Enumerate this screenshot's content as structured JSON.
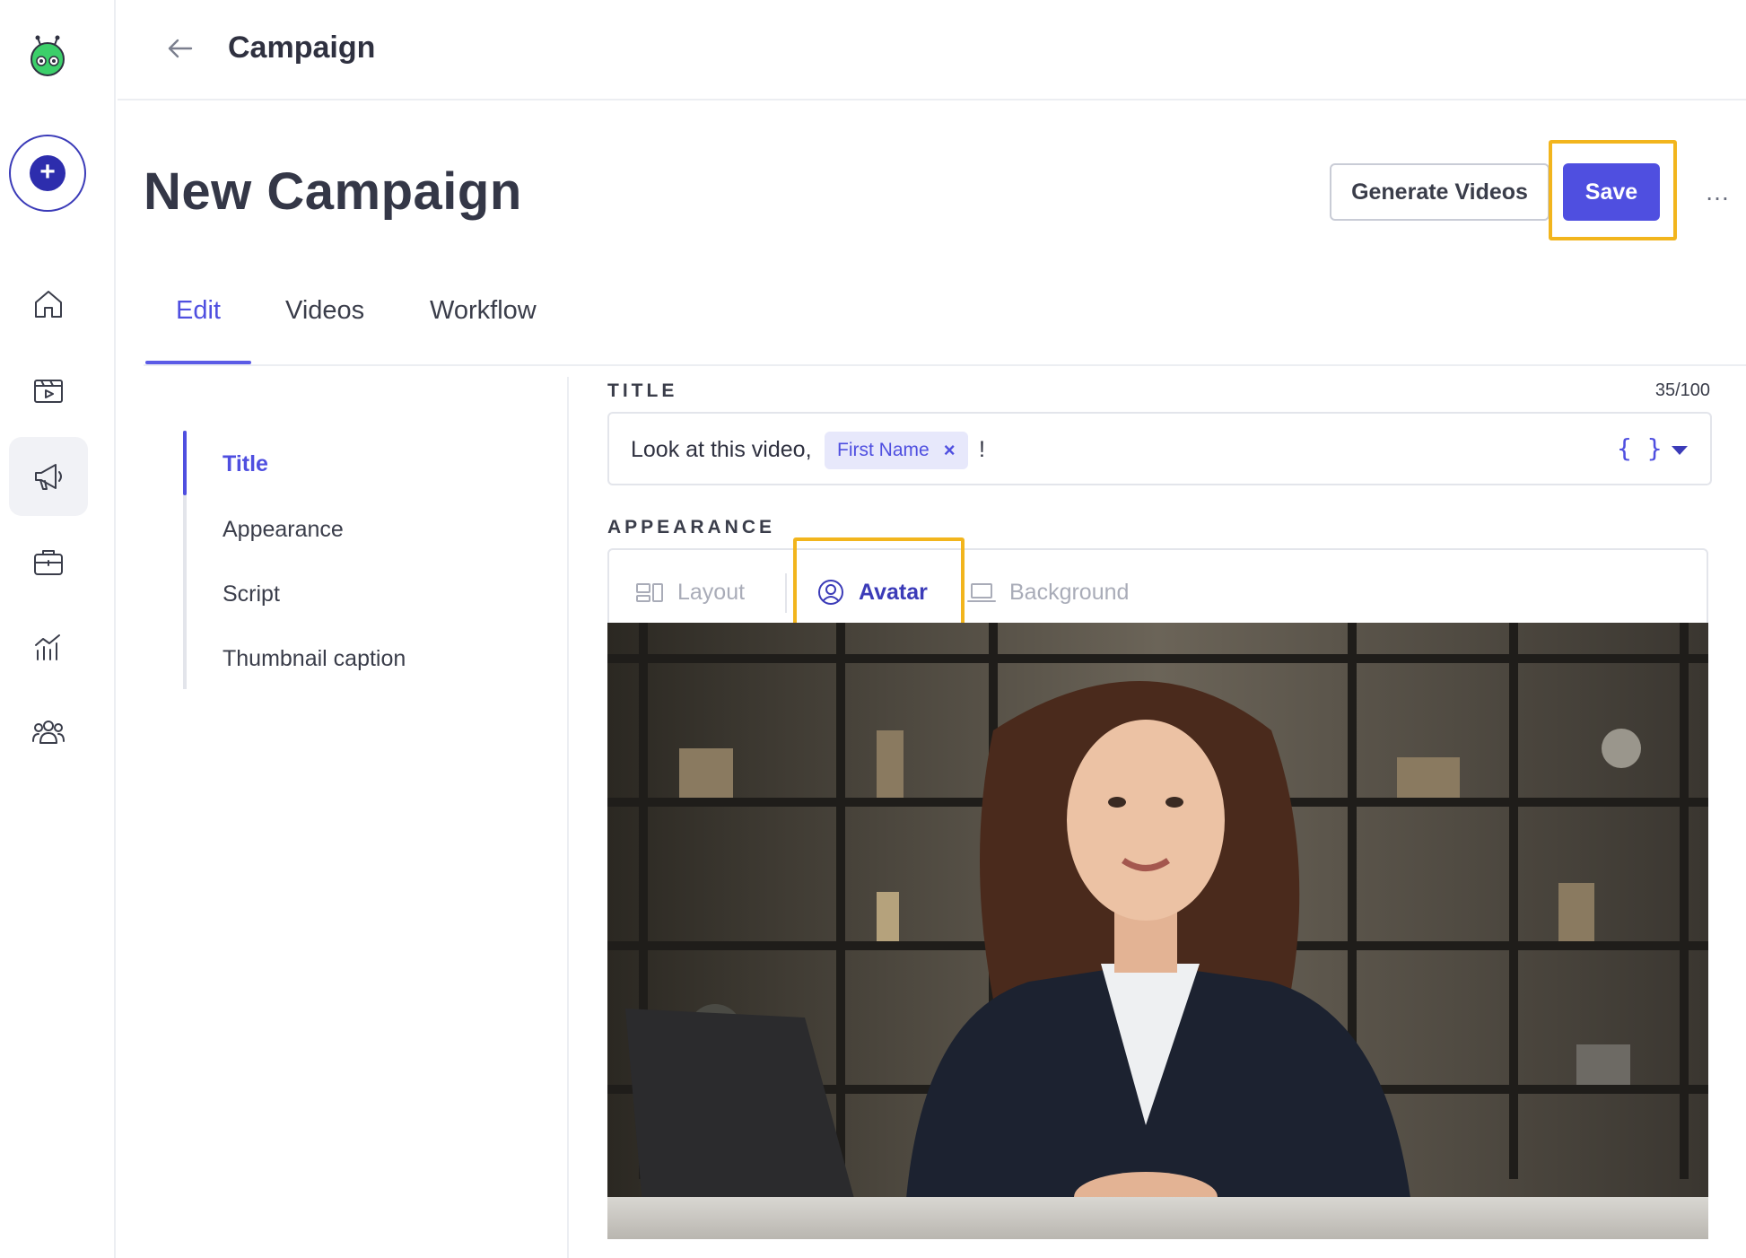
{
  "topbar": {
    "title": "Campaign"
  },
  "header": {
    "page_title": "New Campaign",
    "generate_label": "Generate Videos",
    "save_label": "Save",
    "more_label": "…"
  },
  "tabs": [
    {
      "label": "Edit",
      "active": true
    },
    {
      "label": "Videos",
      "active": false
    },
    {
      "label": "Workflow",
      "active": false
    }
  ],
  "subnav": [
    {
      "label": "Title",
      "active": true
    },
    {
      "label": "Appearance",
      "active": false
    },
    {
      "label": "Script",
      "active": false
    },
    {
      "label": "Thumbnail caption",
      "active": false
    }
  ],
  "title_field": {
    "label": "TITLE",
    "char_count": "35/100",
    "text": "Look at this video,",
    "variable_chip": "First Name",
    "suffix": "!",
    "variables_icon": "{ }"
  },
  "appearance": {
    "label": "APPEARANCE",
    "tabs": [
      {
        "label": "Layout",
        "icon": "layout-icon",
        "state": "disabled"
      },
      {
        "label": "Avatar",
        "icon": "avatar-icon",
        "state": "active"
      },
      {
        "label": "Background",
        "icon": "laptop-icon",
        "state": "disabled"
      }
    ]
  },
  "sidebar": {
    "items": [
      {
        "icon": "home-icon"
      },
      {
        "icon": "video-clapper-icon"
      },
      {
        "icon": "megaphone-icon",
        "active": true
      },
      {
        "icon": "briefcase-icon"
      },
      {
        "icon": "analytics-icon"
      },
      {
        "icon": "team-icon"
      }
    ]
  },
  "colors": {
    "accent": "#4f4fe0",
    "highlight": "#f2b51d",
    "text": "#3a3d4a",
    "border": "#e3e5eb"
  }
}
